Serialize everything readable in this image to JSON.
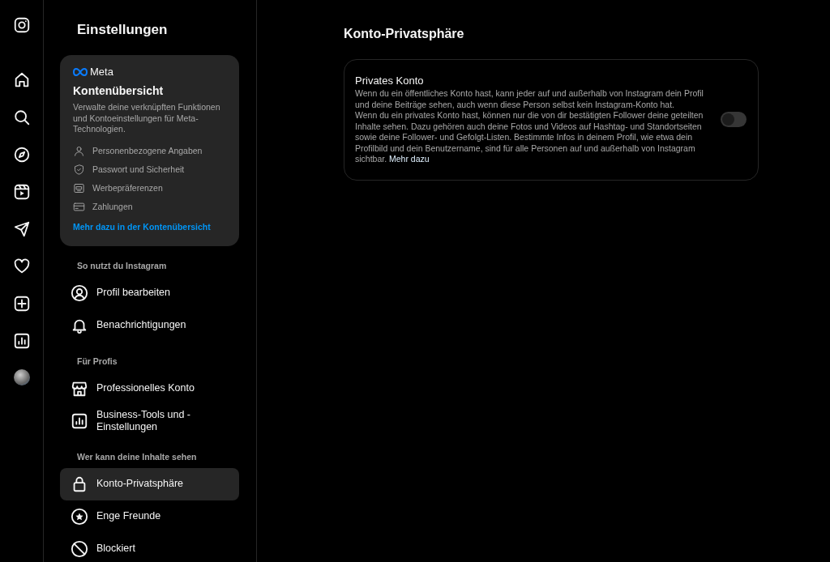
{
  "settings": {
    "title": "Einstellungen",
    "accounts_card": {
      "brand": "Meta",
      "title": "Kontenübersicht",
      "description": "Verwalte deine verknüpften Funktionen und Kontoeinstellungen für Meta-Technologien.",
      "items": [
        "Personenbezogene Angaben",
        "Passwort und Sicherheit",
        "Werbepräferenzen",
        "Zahlungen"
      ],
      "link": "Mehr dazu in der Kontenübersicht"
    },
    "sections": [
      {
        "heading": "So nutzt du Instagram",
        "items": [
          {
            "label": "Profil bearbeiten",
            "selected": false
          },
          {
            "label": "Benachrichtigungen",
            "selected": false
          }
        ]
      },
      {
        "heading": "Für Profis",
        "items": [
          {
            "label": "Professionelles Konto",
            "selected": false
          },
          {
            "label": "Business-Tools und -Einstellungen",
            "selected": false
          }
        ]
      },
      {
        "heading": "Wer kann deine Inhalte sehen",
        "items": [
          {
            "label": "Konto-Privatsphäre",
            "selected": true
          },
          {
            "label": "Enge Freunde",
            "selected": false
          },
          {
            "label": "Blockiert",
            "selected": false
          }
        ]
      }
    ]
  },
  "main": {
    "title": "Konto-Privatsphäre",
    "setting": {
      "title": "Privates Konto",
      "on": false,
      "description": [
        "Wenn du ein öffentliches Konto hast, kann jeder auf und außerhalb von Instagram dein Profil und deine Beiträge sehen, auch wenn diese Person selbst kein Instagram-Konto hat.",
        "Wenn du ein privates Konto hast, können nur die von dir bestätigten Follower deine geteilten Inhalte sehen. Dazu gehören auch deine Fotos und Videos auf Hashtag- und Standortseiten sowie deine Follower- und Gefolgt-Listen. Bestimmte Infos in deinem Profil, wie etwa dein Profilbild und dein Benutzername, sind für alle Personen auf und außerhalb von Instagram sichtbar."
      ],
      "link": "Mehr dazu"
    }
  }
}
